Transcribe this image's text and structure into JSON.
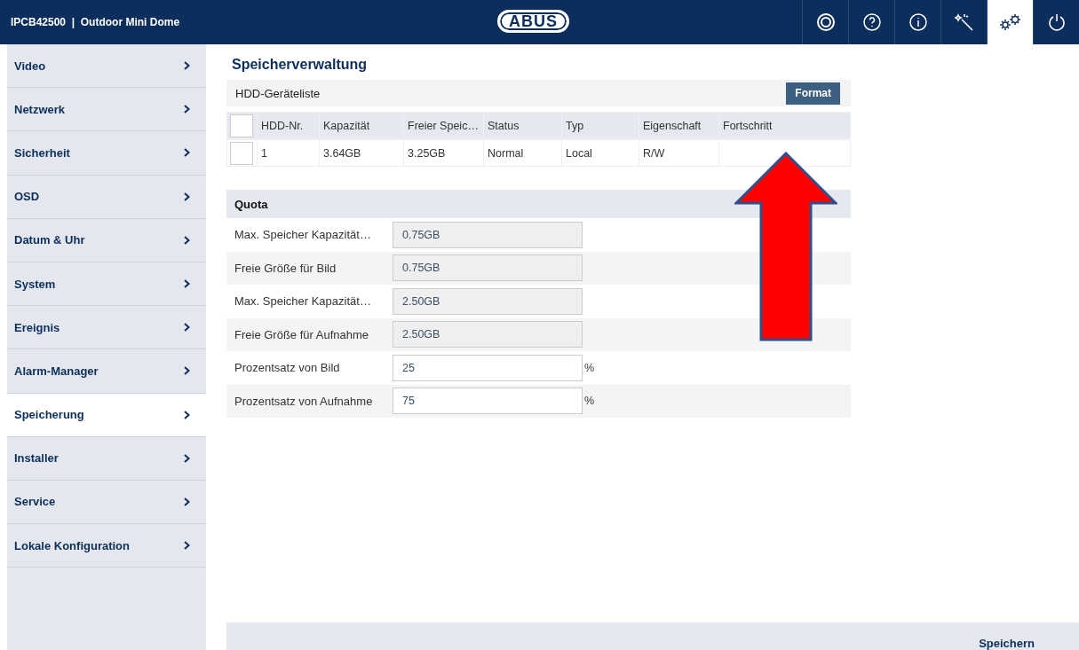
{
  "header": {
    "device": "IPCB42500",
    "separator": "|",
    "model": "Outdoor Mini Dome",
    "logo": "ABUS",
    "icon_buttons": [
      {
        "selected": false
      },
      {
        "selected": false
      },
      {
        "selected": false
      },
      {
        "selected": false
      },
      {
        "selected": true
      },
      {
        "selected": false
      }
    ]
  },
  "sidebar": {
    "items": [
      {
        "label": "Video",
        "selected": false
      },
      {
        "label": "Netzwerk",
        "selected": false
      },
      {
        "label": "Sicherheit",
        "selected": false
      },
      {
        "label": "OSD",
        "selected": false
      },
      {
        "label": "Datum & Uhr",
        "selected": false
      },
      {
        "label": "System",
        "selected": false
      },
      {
        "label": "Ereignis",
        "selected": false
      },
      {
        "label": "Alarm-Manager",
        "selected": false
      },
      {
        "label": "Speicherung",
        "selected": true
      },
      {
        "label": "Installer",
        "selected": false
      },
      {
        "label": "Service",
        "selected": false
      },
      {
        "label": "Lokale Konfiguration",
        "selected": false
      }
    ]
  },
  "page_title": "Speicherverwaltung",
  "hdd": {
    "title": "HDD-Geräteliste",
    "format_button": "Format",
    "header_checked": false,
    "columns": [
      "HDD-Nr.",
      "Kapazität",
      "Freier Speic…",
      "Status",
      "Typ",
      "Eigenschaft",
      "Fortschritt"
    ],
    "rows": [
      {
        "checked": false,
        "cells": [
          "1",
          "3.64GB",
          "3.25GB",
          "Normal",
          "Local",
          "R/W",
          ""
        ]
      }
    ]
  },
  "quota": {
    "title": "Quota",
    "rows": [
      {
        "label": "Max. Speicher Kapazität…",
        "value": "0.75GB",
        "disabled": true
      },
      {
        "label": "Freie Größe für Bild",
        "value": "0.75GB",
        "disabled": true
      },
      {
        "label": "Max. Speicher Kapazität…",
        "value": "2.50GB",
        "disabled": true
      },
      {
        "label": "Freie Größe für Aufnahme",
        "value": "2.50GB",
        "disabled": true
      },
      {
        "label": "Prozentsatz von Bild",
        "value": "25",
        "disabled": false,
        "unit": "%"
      },
      {
        "label": "Prozentsatz von Aufnahme",
        "value": "75",
        "disabled": false,
        "unit": "%"
      }
    ]
  },
  "annotation": {
    "kind": "arrow"
  },
  "save_button": "Speichern"
}
